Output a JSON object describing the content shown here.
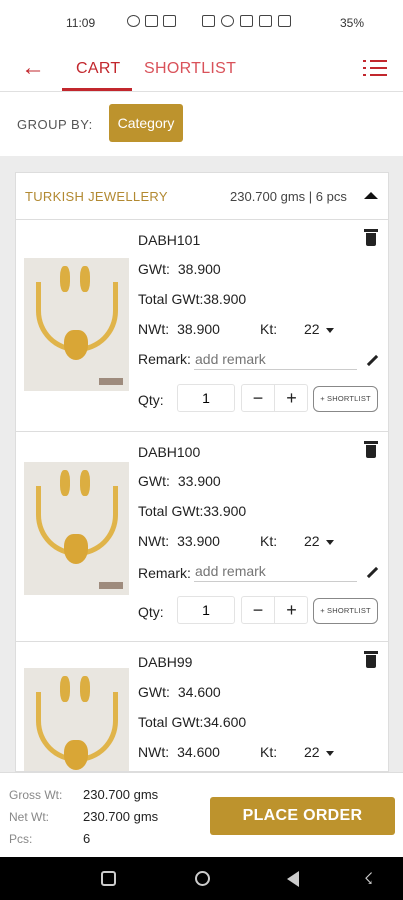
{
  "status_bar": {
    "time": "11:09",
    "battery": "35%"
  },
  "header": {
    "back_icon": "back-arrow-icon",
    "tabs": [
      {
        "label": "CART",
        "active": true
      },
      {
        "label": "SHORTLIST",
        "active": false
      }
    ],
    "menu_icon": "list-menu-icon",
    "accent_color": "#c2272d"
  },
  "group_by": {
    "label": "GROUP BY:",
    "value": "Category",
    "button_color": "#bd932d"
  },
  "category": {
    "name": "TURKISH JEWELLERY",
    "summary": "230.700 gms | 6 pcs"
  },
  "items": [
    {
      "code": "DABH101",
      "gwt_label": "GWt:",
      "gwt": "38.900",
      "total_gwt_label": "Total GWt:",
      "total_gwt": "38.900",
      "nwt_label": "NWt:",
      "nwt": "38.900",
      "kt_label": "Kt:",
      "kt": "22",
      "remark_label": "Remark:",
      "remark_placeholder": "add remark",
      "qty_label": "Qty:",
      "qty": "1",
      "shortlist_label": "+ SHORTLIST"
    },
    {
      "code": "DABH100",
      "gwt_label": "GWt:",
      "gwt": "33.900",
      "total_gwt_label": "Total GWt:",
      "total_gwt": "33.900",
      "nwt_label": "NWt:",
      "nwt": "33.900",
      "kt_label": "Kt:",
      "kt": "22",
      "remark_label": "Remark:",
      "remark_placeholder": "add remark",
      "qty_label": "Qty:",
      "qty": "1",
      "shortlist_label": "+ SHORTLIST"
    },
    {
      "code": "DABH99",
      "gwt_label": "GWt:",
      "gwt": "34.600",
      "total_gwt_label": "Total GWt:",
      "total_gwt": "34.600",
      "nwt_label": "NWt:",
      "nwt": "34.600",
      "kt_label": "Kt:",
      "kt": "22"
    }
  ],
  "summary": {
    "gross_label": "Gross Wt:",
    "gross": "230.700 gms",
    "net_label": "Net Wt:",
    "net": "230.700 gms",
    "pcs_label": "Pcs:",
    "pcs": "6",
    "place_order": "PLACE ORDER"
  }
}
